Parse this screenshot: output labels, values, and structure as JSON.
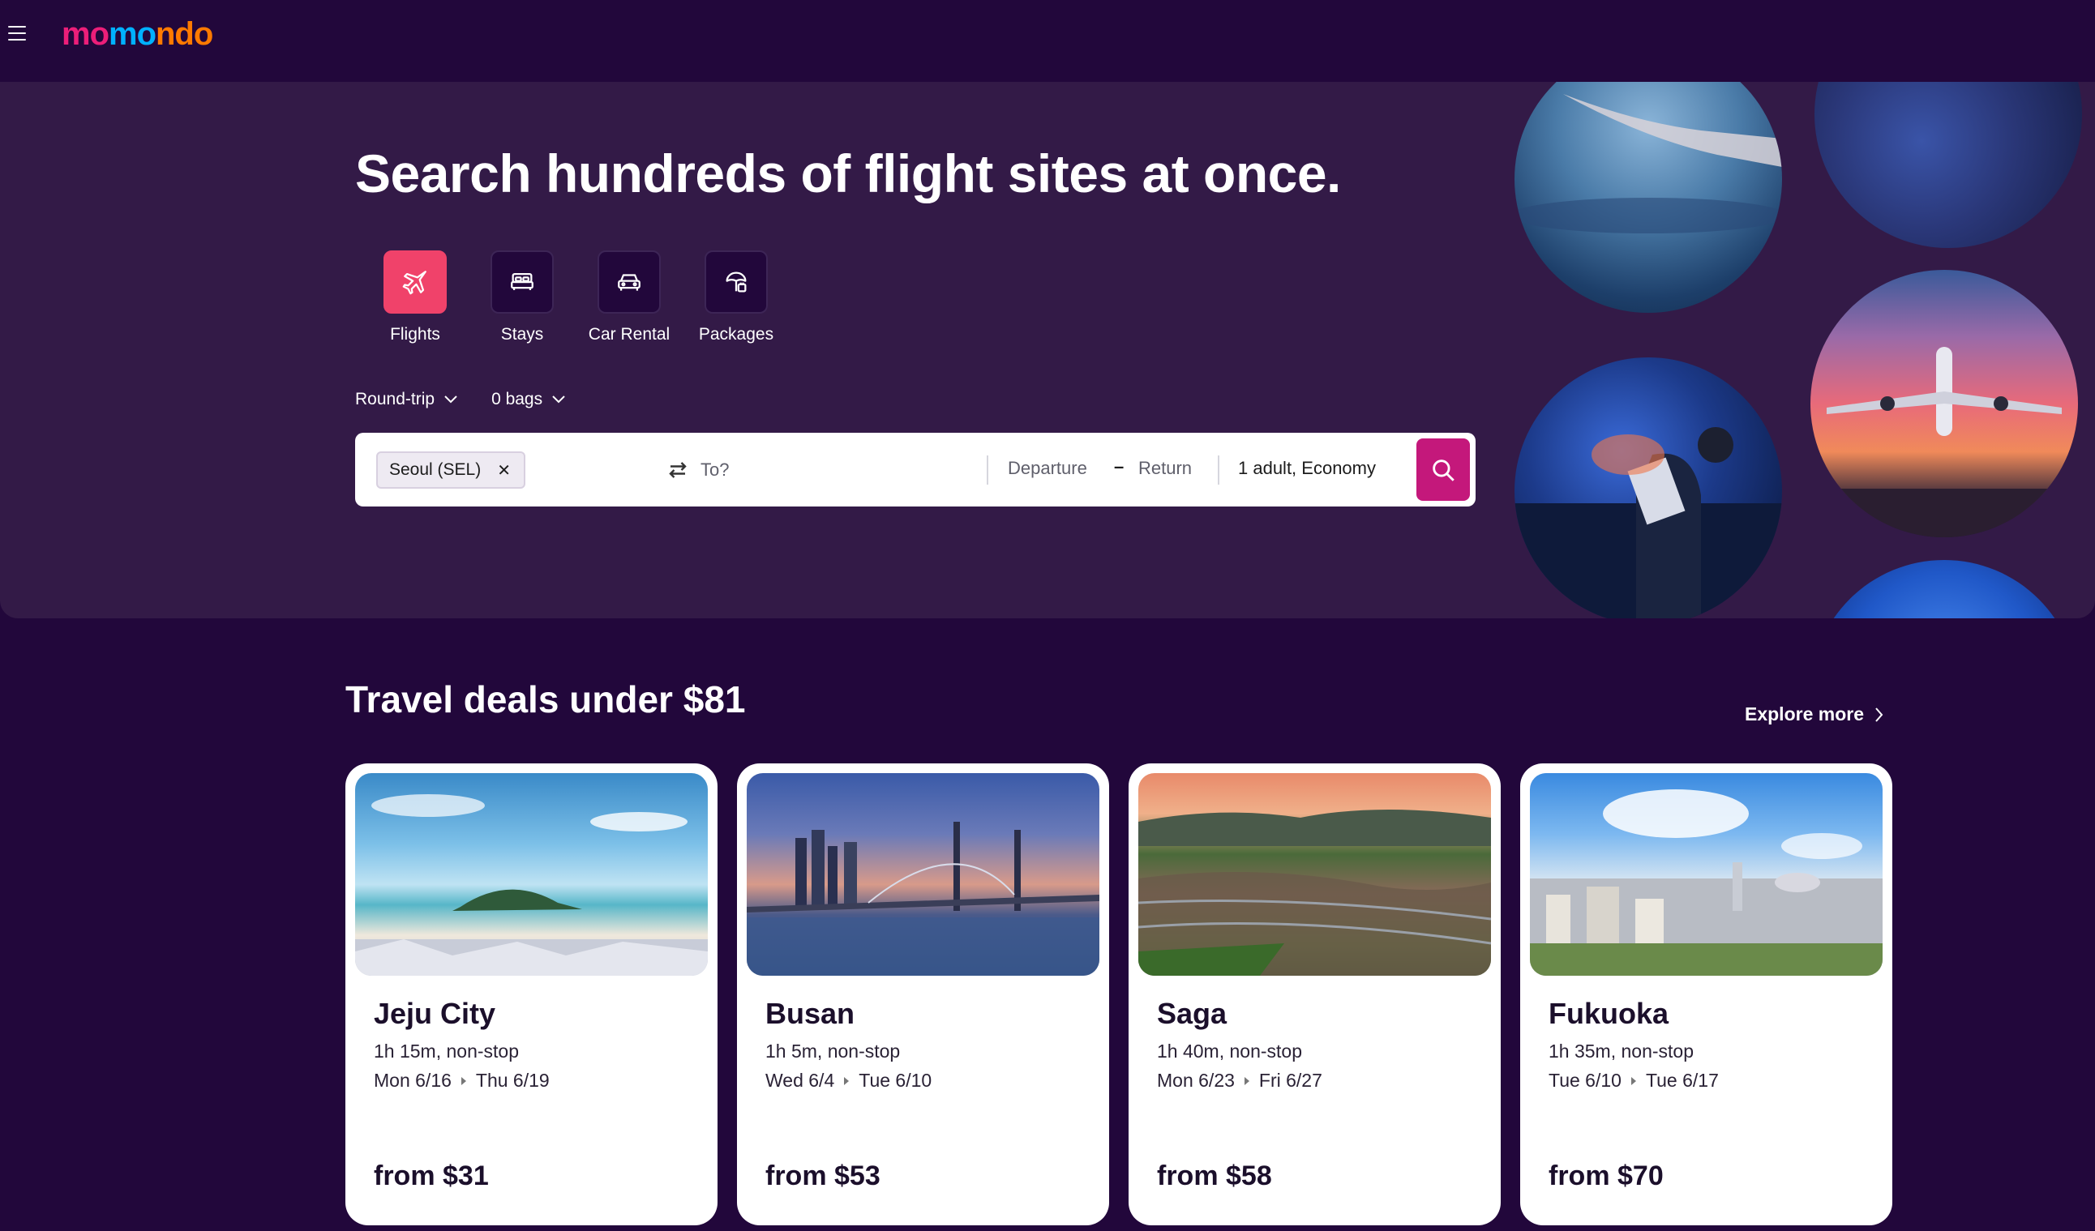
{
  "brand": {
    "logo_part1": "mo",
    "logo_part2": "mo",
    "logo_part3": "ndo",
    "colors": {
      "pink": "#ec1e79",
      "blue": "#00b1ff",
      "orange": "#ff7a00",
      "bg": "#22073b",
      "hero": "#331a47",
      "accent": "#c4187b",
      "flights_active": "#f0426a"
    }
  },
  "hero": {
    "title": "Search hundreds of flight sites at once.",
    "verticals": [
      {
        "label": "Flights",
        "icon": "plane-icon",
        "active": true
      },
      {
        "label": "Stays",
        "icon": "bed-icon",
        "active": false
      },
      {
        "label": "Car Rental",
        "icon": "car-icon",
        "active": false
      },
      {
        "label": "Packages",
        "icon": "beach-umbrella-icon",
        "active": false
      }
    ],
    "options": {
      "trip_type": "Round-trip",
      "bags": "0 bags"
    },
    "search": {
      "origin_chip": "Seoul (SEL)",
      "destination_placeholder": "To?",
      "departure": "Departure",
      "date_separator": "–",
      "return": "Return",
      "travelers": "1 adult, Economy"
    }
  },
  "deals": {
    "title": "Travel deals under $81",
    "explore_more": "Explore more",
    "cards": [
      {
        "city": "Jeju City",
        "duration": "1h 15m, non-stop",
        "depart": "Mon 6/16",
        "return": "Thu 6/19",
        "price": "from $31"
      },
      {
        "city": "Busan",
        "duration": "1h 5m, non-stop",
        "depart": "Wed 6/4",
        "return": "Tue 6/10",
        "price": "from $53"
      },
      {
        "city": "Saga",
        "duration": "1h 40m, non-stop",
        "depart": "Mon 6/23",
        "return": "Fri 6/27",
        "price": "from $58"
      },
      {
        "city": "Fukuoka",
        "duration": "1h 35m, non-stop",
        "depart": "Tue 6/10",
        "return": "Tue 6/17",
        "price": "from $70"
      }
    ]
  }
}
